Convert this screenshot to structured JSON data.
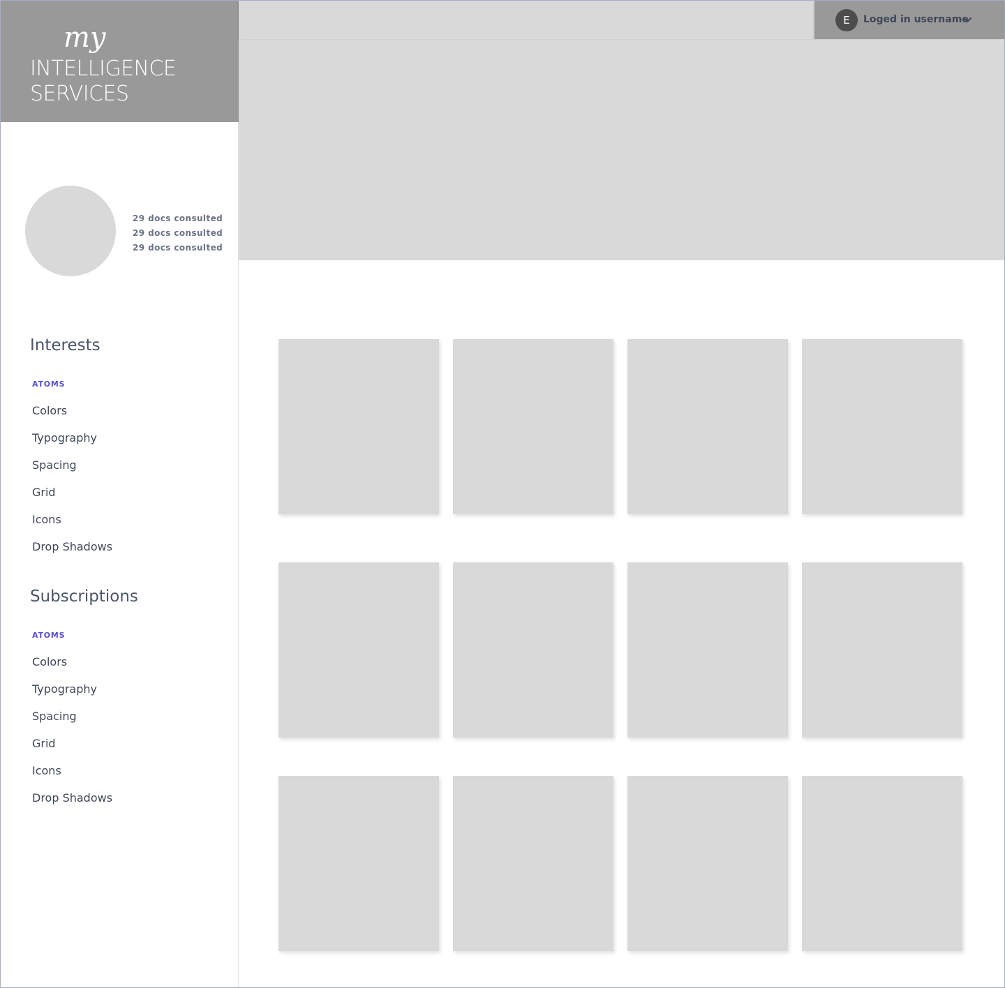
{
  "brand": {
    "line_my": "my",
    "line_1": "INTELLIGENCE",
    "line_2": "SERVICES"
  },
  "user": {
    "initial": "E",
    "name": "Loged in username",
    "dropdown_icon": "chevron-down-icon"
  },
  "profile": {
    "stats": [
      "29 docs consulted",
      "29 docs consulted",
      "29 docs consulted"
    ]
  },
  "interests": {
    "title": "Interests",
    "category": "ATOMS",
    "items": [
      "Colors",
      "Typography",
      "Spacing",
      "Grid",
      "Icons",
      "Drop Shadows"
    ]
  },
  "subscriptions": {
    "title": "Subscriptions",
    "category": "ATOMS",
    "items": [
      "Colors",
      "Typography",
      "Spacing",
      "Grid",
      "Icons",
      "Drop Shadows"
    ]
  },
  "colors": {
    "placeholder_gray": "#d9d9d9",
    "brand_gray": "#999999",
    "accent": "#5a4fcf",
    "text": "#3f4756"
  }
}
